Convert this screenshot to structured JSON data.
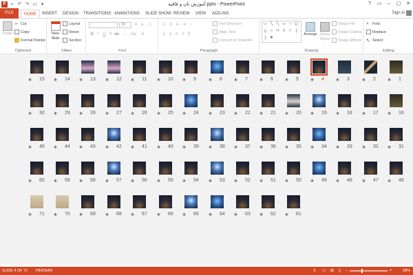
{
  "window": {
    "title": "آموزش نان و قافیه.pptx - PowerPoint",
    "controls": [
      "?",
      "▭",
      "–",
      "▢",
      "✕"
    ]
  },
  "tabs": [
    "FILE",
    "HOME",
    "INSERT",
    "DESIGN",
    "TRANSITIONS",
    "ANIMATIONS",
    "SLIDE SHOW",
    "REVIEW",
    "VIEW",
    "ADD-INS"
  ],
  "active_tab": "HOME",
  "signin": "Sign in",
  "ribbon": {
    "clipboard": {
      "label": "Clipboard",
      "paste": "Paste",
      "cut": "Cut",
      "copy": "Copy",
      "format_painter": "Format Painter"
    },
    "slides": {
      "label": "Slides",
      "new_slide": "New Slide",
      "layout": "Layout",
      "reset": "Reset",
      "section": "Section"
    },
    "font": {
      "label": "Font",
      "size": "72"
    },
    "paragraph": {
      "label": "Paragraph",
      "text_direction": "Text Direction",
      "align_text": "Align Text",
      "convert_smartart": "Convert to SmartArt"
    },
    "drawing": {
      "label": "Drawing",
      "arrange": "Arrange",
      "quick_styles": "Quick Styles",
      "shape_fill": "Shape Fill",
      "shape_outline": "Shape Outline",
      "shape_effects": "Shape Effects"
    },
    "editing": {
      "label": "Editing",
      "find": "Find",
      "replace": "Replace",
      "select": "Select"
    }
  },
  "slides": {
    "selected": 4,
    "rows": [
      [
        15,
        14,
        13,
        12,
        11,
        10,
        9,
        8,
        7,
        6,
        5,
        4,
        3,
        2,
        1
      ],
      [
        30,
        29,
        28,
        27,
        26,
        25,
        24,
        23,
        22,
        21,
        20,
        19,
        18,
        17,
        16
      ],
      [
        45,
        44,
        43,
        42,
        41,
        40,
        39,
        38,
        37,
        36,
        35,
        34,
        33,
        32,
        31
      ],
      [
        60,
        59,
        58,
        57,
        56,
        55,
        54,
        53,
        52,
        51,
        50,
        49,
        48,
        47,
        46
      ],
      [
        71,
        70,
        69,
        68,
        67,
        66,
        65,
        64,
        63,
        62,
        61
      ]
    ],
    "variants": {
      "1": "title",
      "2": "stairs",
      "3": "dark",
      "8": "blue",
      "16": "title",
      "19": "glow",
      "20": "book",
      "24": "blue",
      "34": "blue",
      "38": "glow",
      "42": "glow",
      "49": "blue",
      "53": "glow",
      "57": "glow",
      "64": "blue",
      "65": "glow",
      "70": "light",
      "71": "light",
      "12": "pink",
      "13": "pink"
    }
  },
  "status": {
    "slide_info": "SLIDE 4 OF 71",
    "language": "PERSIAN",
    "zoom": "28%"
  },
  "colors": {
    "accent": "#d24726"
  }
}
